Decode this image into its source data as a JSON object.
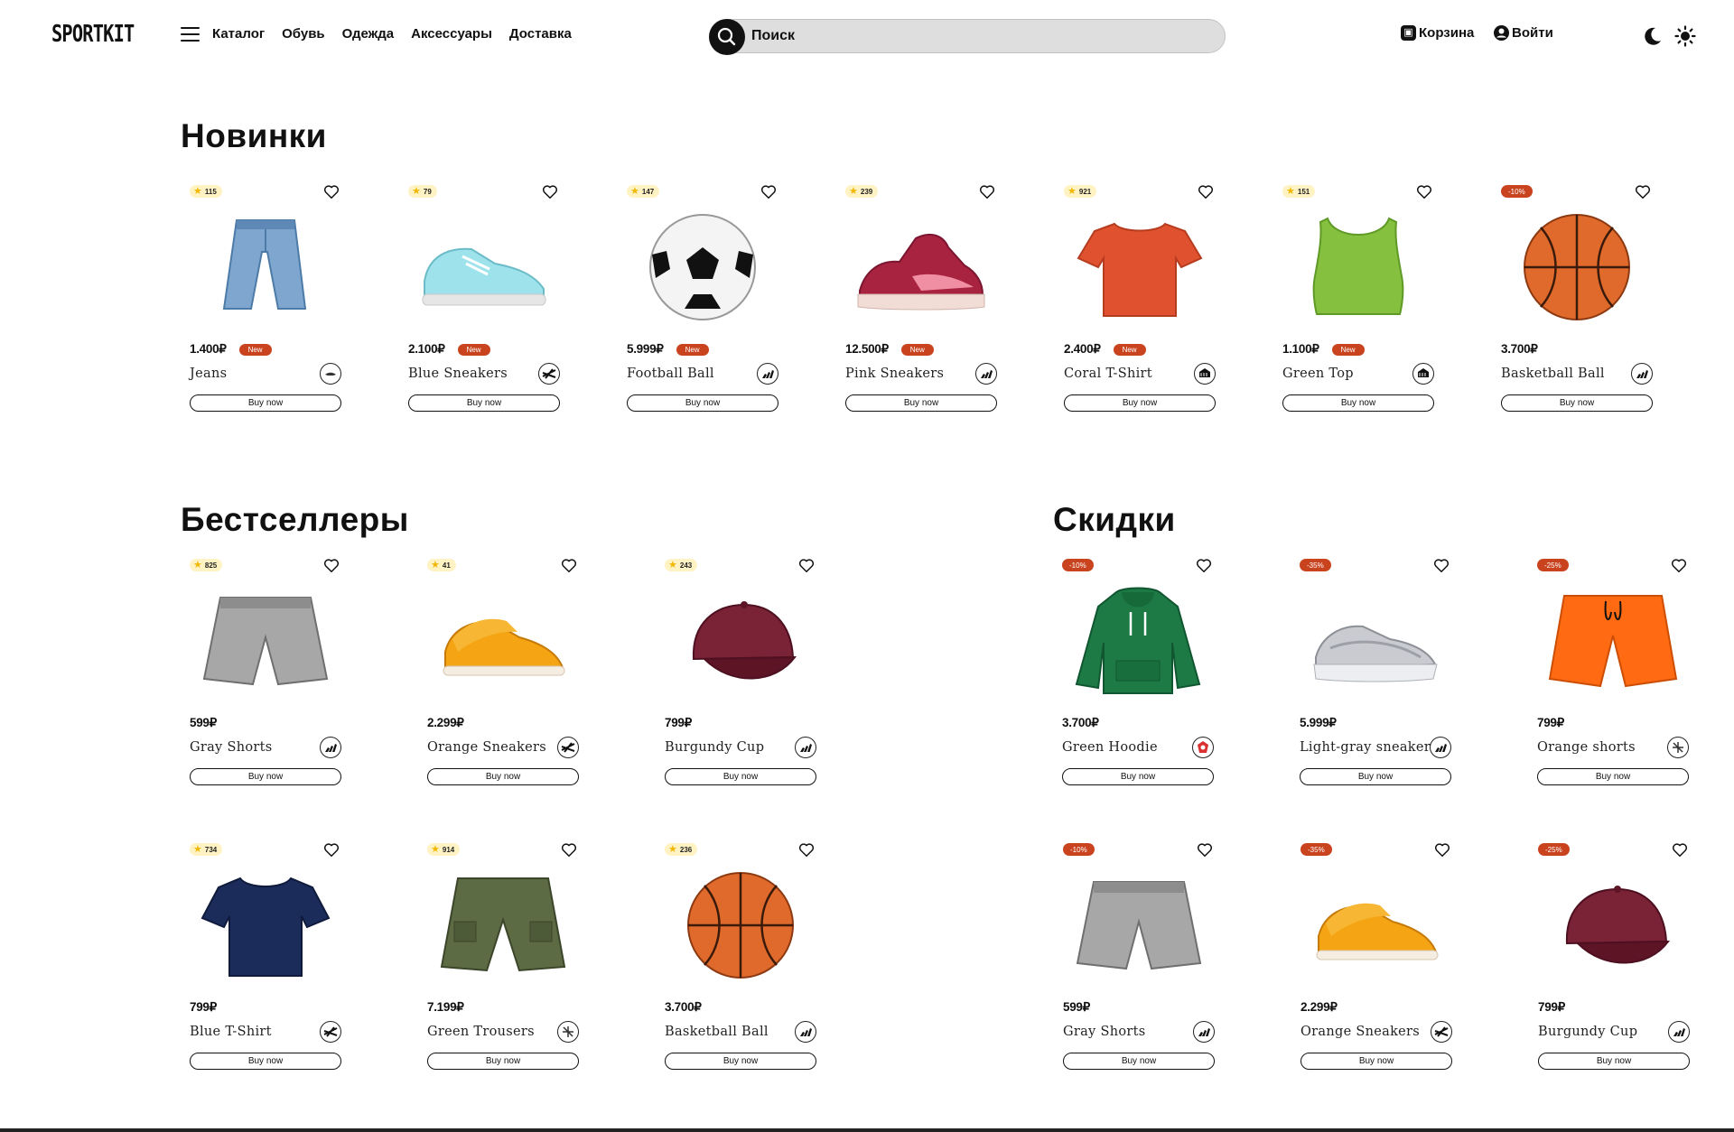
{
  "header": {
    "logo": "SPORTKIT",
    "nav": [
      "Каталог",
      "Обувь",
      "Одежда",
      "Аксессуары",
      "Доставка"
    ],
    "search_placeholder": "Поиск",
    "cart_label": "Корзина",
    "login_label": "Войти"
  },
  "buy_label": "Buy now",
  "new_label": "New",
  "sections": {
    "new": {
      "title": "Новинки",
      "items": [
        {
          "name": "Jeans",
          "price": "1.400₽",
          "rating": "115",
          "discount": null,
          "is_new": true,
          "image": "jeans",
          "brand": "lacoste"
        },
        {
          "name": "Blue Sneakers",
          "price": "2.100₽",
          "rating": "79",
          "discount": null,
          "is_new": true,
          "image": "blue-sneakers",
          "brand": "reebok"
        },
        {
          "name": "Football Ball",
          "price": "5.999₽",
          "rating": "147",
          "discount": null,
          "is_new": true,
          "image": "football",
          "brand": "adidas"
        },
        {
          "name": "Pink Sneakers",
          "price": "12.500₽",
          "rating": "239",
          "discount": null,
          "is_new": true,
          "image": "pink-sneakers",
          "brand": "adidas"
        },
        {
          "name": "Coral T-Shirt",
          "price": "2.400₽",
          "rating": "921",
          "discount": null,
          "is_new": true,
          "image": "coral-tshirt",
          "brand": "umbro"
        },
        {
          "name": "Green Top",
          "price": "1.100₽",
          "rating": "151",
          "discount": null,
          "is_new": true,
          "image": "green-top",
          "brand": "umbro"
        },
        {
          "name": "Basketball Ball",
          "price": "3.700₽",
          "rating": null,
          "discount": "-10%",
          "is_new": false,
          "image": "basketball",
          "brand": "adidas"
        }
      ]
    },
    "bestsellers": {
      "title": "Бестселлеры",
      "items": [
        {
          "name": "Gray Shorts",
          "price": "599₽",
          "rating": "825",
          "discount": null,
          "image": "gray-shorts",
          "brand": "adidas"
        },
        {
          "name": "Orange Sneakers",
          "price": "2.299₽",
          "rating": "41",
          "discount": null,
          "image": "orange-sneakers",
          "brand": "reebok"
        },
        {
          "name": "Burgundy Cup",
          "price": "799₽",
          "rating": "243",
          "discount": null,
          "image": "burgundy-cap",
          "brand": "adidas"
        },
        {
          "name": "Blue T-Shirt",
          "price": "799₽",
          "rating": "734",
          "discount": null,
          "image": "blue-tshirt",
          "brand": "reebok"
        },
        {
          "name": "Green Trousers",
          "price": "7.199₽",
          "rating": "914",
          "discount": null,
          "image": "green-trousers",
          "brand": "fila"
        },
        {
          "name": "Basketball Ball",
          "price": "3.700₽",
          "rating": "236",
          "discount": null,
          "image": "basketball",
          "brand": "adidas"
        }
      ]
    },
    "sale": {
      "title": "Скидки",
      "items": [
        {
          "name": "Green Hoodie",
          "price": "3.700₽",
          "rating": null,
          "discount": "-10%",
          "image": "green-hoodie",
          "brand": "red-mark"
        },
        {
          "name": "Light-gray sneakers",
          "price": "5.999₽",
          "rating": null,
          "discount": "-35%",
          "image": "gray-sneakers",
          "brand": "adidas"
        },
        {
          "name": "Orange shorts",
          "price": "799₽",
          "rating": null,
          "discount": "-25%",
          "image": "orange-shorts",
          "brand": "fila"
        },
        {
          "name": "Gray Shorts",
          "price": "599₽",
          "rating": null,
          "discount": "-10%",
          "image": "gray-shorts",
          "brand": "adidas"
        },
        {
          "name": "Orange Sneakers",
          "price": "2.299₽",
          "rating": null,
          "discount": "-35%",
          "image": "orange-sneakers",
          "brand": "reebok"
        },
        {
          "name": "Burgundy Cup",
          "price": "799₽",
          "rating": null,
          "discount": "-25%",
          "image": "burgundy-cap",
          "brand": "adidas"
        }
      ]
    }
  },
  "colors": {
    "accent": "#c9431f",
    "rating_bg": "#fff3c4",
    "star": "#f2b705",
    "search_bg": "#dedede"
  }
}
